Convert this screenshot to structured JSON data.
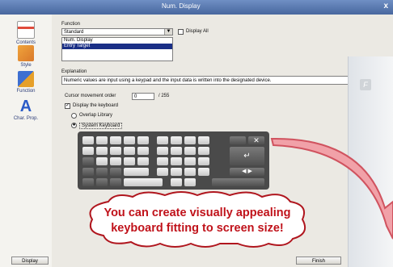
{
  "window": {
    "title": "Num. Display",
    "close_glyph": "x"
  },
  "sidebar": {
    "items": [
      {
        "label": "Contents",
        "icon": "contents-icon"
      },
      {
        "label": "Style",
        "icon": "style-icon"
      },
      {
        "label": "Function",
        "icon": "function-icon"
      },
      {
        "label": "Char. Prop.",
        "icon": "char-prop-icon"
      }
    ]
  },
  "function": {
    "label": "Function",
    "selected": "Standard",
    "display_all_label": "Display All",
    "options": [
      "Num. Display",
      "Entry Target"
    ],
    "selected_option": "Entry Target"
  },
  "explanation": {
    "label": "Explanation",
    "text": "Numeric values are input using a keypad and the input data is written into the designated device."
  },
  "cursor": {
    "label": "Cursor movement order",
    "value": "0",
    "max": "/ 255"
  },
  "keyboard": {
    "display_label": "Display the keyboard",
    "overlap_label": "Overlap Library",
    "system_label": "System Keyboard",
    "display_checked": "✓",
    "system_selected": "●"
  },
  "footer": {
    "finish_label": "Finish",
    "left_label": "Display"
  },
  "callout": {
    "line1": "You can create visually appealing",
    "line2": "keyboard fitting to screen size!"
  }
}
